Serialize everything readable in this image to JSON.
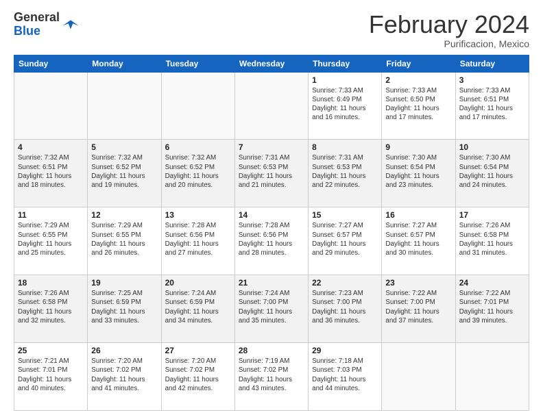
{
  "logo": {
    "general": "General",
    "blue": "Blue"
  },
  "header": {
    "month": "February 2024",
    "location": "Purificacion, Mexico"
  },
  "days_of_week": [
    "Sunday",
    "Monday",
    "Tuesday",
    "Wednesday",
    "Thursday",
    "Friday",
    "Saturday"
  ],
  "weeks": [
    [
      {
        "day": "",
        "info": ""
      },
      {
        "day": "",
        "info": ""
      },
      {
        "day": "",
        "info": ""
      },
      {
        "day": "",
        "info": ""
      },
      {
        "day": "1",
        "info": "Sunrise: 7:33 AM\nSunset: 6:49 PM\nDaylight: 11 hours and 16 minutes."
      },
      {
        "day": "2",
        "info": "Sunrise: 7:33 AM\nSunset: 6:50 PM\nDaylight: 11 hours and 17 minutes."
      },
      {
        "day": "3",
        "info": "Sunrise: 7:33 AM\nSunset: 6:51 PM\nDaylight: 11 hours and 17 minutes."
      }
    ],
    [
      {
        "day": "4",
        "info": "Sunrise: 7:32 AM\nSunset: 6:51 PM\nDaylight: 11 hours and 18 minutes."
      },
      {
        "day": "5",
        "info": "Sunrise: 7:32 AM\nSunset: 6:52 PM\nDaylight: 11 hours and 19 minutes."
      },
      {
        "day": "6",
        "info": "Sunrise: 7:32 AM\nSunset: 6:52 PM\nDaylight: 11 hours and 20 minutes."
      },
      {
        "day": "7",
        "info": "Sunrise: 7:31 AM\nSunset: 6:53 PM\nDaylight: 11 hours and 21 minutes."
      },
      {
        "day": "8",
        "info": "Sunrise: 7:31 AM\nSunset: 6:53 PM\nDaylight: 11 hours and 22 minutes."
      },
      {
        "day": "9",
        "info": "Sunrise: 7:30 AM\nSunset: 6:54 PM\nDaylight: 11 hours and 23 minutes."
      },
      {
        "day": "10",
        "info": "Sunrise: 7:30 AM\nSunset: 6:54 PM\nDaylight: 11 hours and 24 minutes."
      }
    ],
    [
      {
        "day": "11",
        "info": "Sunrise: 7:29 AM\nSunset: 6:55 PM\nDaylight: 11 hours and 25 minutes."
      },
      {
        "day": "12",
        "info": "Sunrise: 7:29 AM\nSunset: 6:55 PM\nDaylight: 11 hours and 26 minutes."
      },
      {
        "day": "13",
        "info": "Sunrise: 7:28 AM\nSunset: 6:56 PM\nDaylight: 11 hours and 27 minutes."
      },
      {
        "day": "14",
        "info": "Sunrise: 7:28 AM\nSunset: 6:56 PM\nDaylight: 11 hours and 28 minutes."
      },
      {
        "day": "15",
        "info": "Sunrise: 7:27 AM\nSunset: 6:57 PM\nDaylight: 11 hours and 29 minutes."
      },
      {
        "day": "16",
        "info": "Sunrise: 7:27 AM\nSunset: 6:57 PM\nDaylight: 11 hours and 30 minutes."
      },
      {
        "day": "17",
        "info": "Sunrise: 7:26 AM\nSunset: 6:58 PM\nDaylight: 11 hours and 31 minutes."
      }
    ],
    [
      {
        "day": "18",
        "info": "Sunrise: 7:26 AM\nSunset: 6:58 PM\nDaylight: 11 hours and 32 minutes."
      },
      {
        "day": "19",
        "info": "Sunrise: 7:25 AM\nSunset: 6:59 PM\nDaylight: 11 hours and 33 minutes."
      },
      {
        "day": "20",
        "info": "Sunrise: 7:24 AM\nSunset: 6:59 PM\nDaylight: 11 hours and 34 minutes."
      },
      {
        "day": "21",
        "info": "Sunrise: 7:24 AM\nSunset: 7:00 PM\nDaylight: 11 hours and 35 minutes."
      },
      {
        "day": "22",
        "info": "Sunrise: 7:23 AM\nSunset: 7:00 PM\nDaylight: 11 hours and 36 minutes."
      },
      {
        "day": "23",
        "info": "Sunrise: 7:22 AM\nSunset: 7:00 PM\nDaylight: 11 hours and 37 minutes."
      },
      {
        "day": "24",
        "info": "Sunrise: 7:22 AM\nSunset: 7:01 PM\nDaylight: 11 hours and 39 minutes."
      }
    ],
    [
      {
        "day": "25",
        "info": "Sunrise: 7:21 AM\nSunset: 7:01 PM\nDaylight: 11 hours and 40 minutes."
      },
      {
        "day": "26",
        "info": "Sunrise: 7:20 AM\nSunset: 7:02 PM\nDaylight: 11 hours and 41 minutes."
      },
      {
        "day": "27",
        "info": "Sunrise: 7:20 AM\nSunset: 7:02 PM\nDaylight: 11 hours and 42 minutes."
      },
      {
        "day": "28",
        "info": "Sunrise: 7:19 AM\nSunset: 7:02 PM\nDaylight: 11 hours and 43 minutes."
      },
      {
        "day": "29",
        "info": "Sunrise: 7:18 AM\nSunset: 7:03 PM\nDaylight: 11 hours and 44 minutes."
      },
      {
        "day": "",
        "info": ""
      },
      {
        "day": "",
        "info": ""
      }
    ]
  ]
}
